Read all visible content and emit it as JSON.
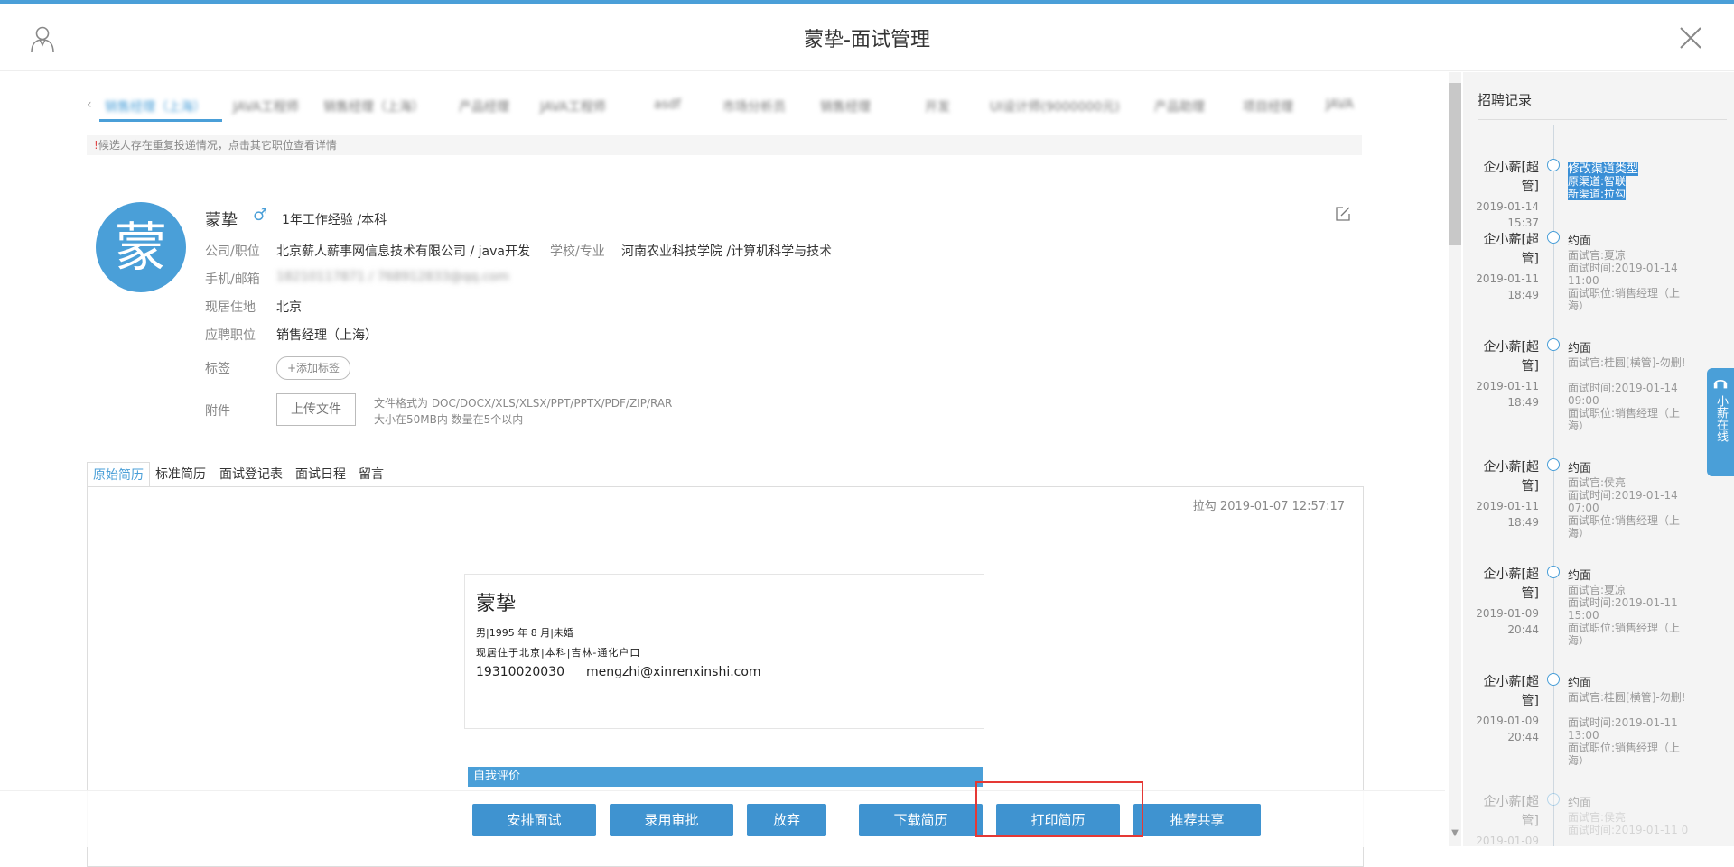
{
  "header": {
    "title": "蒙挚-面试管理",
    "user_icon": "user-icon",
    "close_icon": "close-icon"
  },
  "position_tabs": {
    "items": [
      "销售经理（上海）",
      "JAVA工程师",
      "销售经理（上海）",
      "产品经理",
      "JAVA工程师",
      "asdf",
      "市场分析员",
      "销售经理",
      "开发",
      "UI设计师(9000000元)",
      "产品助理",
      "项目经理",
      "JAVA"
    ],
    "active_index": 0
  },
  "notice": {
    "icon": "!",
    "text": "候选人存在重复投递情况，点击其它职位查看详情"
  },
  "profile": {
    "avatar_char": "蒙",
    "name": "蒙挚",
    "gender_symbol": "♂",
    "meta": "1年工作经验 /本科",
    "company_label": "公司/职位",
    "company_value": "北京薪人薪事网信息技术有限公司 / java开发",
    "school_label": "学校/专业",
    "school_value": "河南农业科技学院 /计算机科学与技术",
    "contact_label": "手机/邮箱",
    "contact_value": "18210117871 / 768912833@qq.com",
    "address_label": "现居住地",
    "address_value": "北京",
    "position_label": "应聘职位",
    "position_value": "销售经理（上海）",
    "tags_label": "标签",
    "add_tag": "+添加标签",
    "attach_label": "附件",
    "upload": "上传文件",
    "hint1": "文件格式为 DOC/DOCX/XLS/XLSX/PPT/PPTX/PDF/ZIP/RAR",
    "hint2": "大小在50MB内 数量在5个以内"
  },
  "subtabs": [
    "原始简历",
    "标准简历",
    "面试登记表",
    "面试日程",
    "留言"
  ],
  "resume": {
    "source_time": "拉勾 2019-01-07 12:57:17",
    "name": "蒙挚",
    "line1": "男|1995 年 8 月|未婚",
    "line2": "现居住于北京|本科|吉林-通化户口",
    "phone": "19310020030",
    "email": "mengzhi@xinrenxinshi.com",
    "self_eval": "自我评价"
  },
  "actions": [
    "安排面试",
    "录用审批",
    "放弃",
    "下载简历",
    "打印简历",
    "推荐共享"
  ],
  "sidebar": {
    "title": "招聘记录",
    "records": [
      {
        "who": "企小薪[超管]",
        "date": "2019-01-14",
        "time": "15:37",
        "action": "修改渠道类型",
        "details": [
          "原渠道:智联",
          "新渠道:拉勾"
        ]
      },
      {
        "who": "企小薪[超管]",
        "date": "2019-01-11",
        "time": "18:49",
        "action": "约面",
        "details": [
          "面试官:夏凉",
          "面试时间:2019-01-14 11:00",
          "面试职位:销售经理（上海）"
        ]
      },
      {
        "who": "企小薪[超管]",
        "date": "2019-01-11",
        "time": "18:49",
        "action": "约面",
        "details": [
          "面试官:桂圆[横管]-勿删!",
          "面试时间:2019-01-14 09:00",
          "面试职位:销售经理（上海）"
        ]
      },
      {
        "who": "企小薪[超管]",
        "date": "2019-01-11",
        "time": "18:49",
        "action": "约面",
        "details": [
          "面试官:侯亮",
          "面试时间:2019-01-14 07:00",
          "面试职位:销售经理（上海）"
        ]
      },
      {
        "who": "企小薪[超管]",
        "date": "2019-01-09",
        "time": "20:44",
        "action": "约面",
        "details": [
          "面试官:夏凉",
          "面试时间:2019-01-11 15:00",
          "面试职位:销售经理（上海）"
        ]
      },
      {
        "who": "企小薪[超管]",
        "date": "2019-01-09",
        "time": "20:44",
        "action": "约面",
        "details": [
          "面试官:桂圆[横管]-勿删!",
          "面试时间:2019-01-11 13:00",
          "面试职位:销售经理（上海）"
        ]
      },
      {
        "who": "企小薪[超管]",
        "date": "2019-01-09",
        "time": "",
        "action": "约面",
        "details": [
          "面试官:侯亮",
          "面试时间:2019-01-11 0"
        ]
      }
    ]
  },
  "online": "小薪在线",
  "colors": {
    "accent": "#4a9fd8",
    "highlight": "#e53935"
  }
}
